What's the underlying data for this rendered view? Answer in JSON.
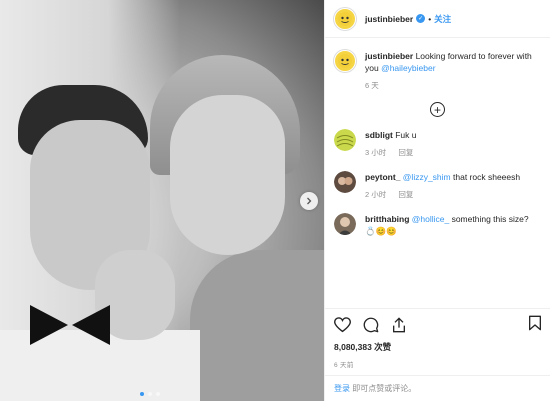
{
  "post": {
    "author": "justinbieber",
    "dot": "•",
    "follow_label": "关注",
    "verified_mark": "✓"
  },
  "caption": {
    "author": "justinbieber",
    "text": "Looking forward to forever with you ",
    "mention": "@haileybieber",
    "age": "6 天"
  },
  "load_more": "+",
  "comments": [
    {
      "user": "sdbligt",
      "text": "Fuk u",
      "mention": "",
      "age": "3 小时",
      "reply": "回复",
      "avatar_color": "#c9d94b"
    },
    {
      "user": "peytont_",
      "mention": "@lizzy_shim",
      "text": " that rock sheeesh",
      "age": "2 小时",
      "reply": "回复",
      "avatar_color": "#6b5a4e"
    },
    {
      "user": "britthabing",
      "mention": "@hollice_",
      "text": " something this size? 💍😊😊",
      "age": "2 小时",
      "reply": "回复",
      "avatar_color": "#8a7a6a"
    }
  ],
  "likes": "8,080,383 次赞",
  "posted": "6 天前",
  "login": {
    "link": "登录",
    "rest": "即可点赞或评论。"
  },
  "colors": {
    "accent": "#3897f0",
    "text": "#262626",
    "muted": "#8e8e8e"
  }
}
